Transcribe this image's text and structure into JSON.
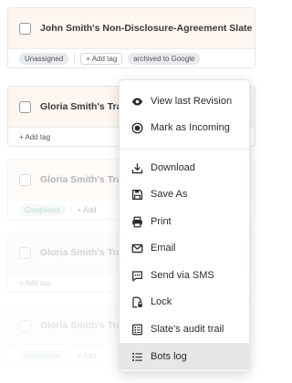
{
  "cards": [
    {
      "title": "John Smith's Non-Disclosure-Agreement Slate",
      "tags": [
        "Unassigned"
      ],
      "add_tag": "+ Add tag",
      "extra_tag": "archived to Google"
    },
    {
      "title": "Gloria Smith's Tra",
      "add_tag": "+ Add tag"
    },
    {
      "title": "Gloria Smith's Tra",
      "status": "Completed",
      "add_tag": "+ Add"
    },
    {
      "title": "Gloria Smith's Tra",
      "add_tag": "+ Add tag"
    },
    {
      "title": "Gloria Smith's Tra",
      "status": "Completed",
      "add_tag": "+ Add"
    }
  ],
  "menu": {
    "items": [
      {
        "label": "View last Revision",
        "icon": "eye-icon"
      },
      {
        "label": "Mark as Incoming",
        "icon": "radio-filled-icon"
      },
      {
        "label": "Download",
        "icon": "download-icon"
      },
      {
        "label": "Save As",
        "icon": "save-icon"
      },
      {
        "label": "Print",
        "icon": "printer-icon"
      },
      {
        "label": "Email",
        "icon": "envelope-icon"
      },
      {
        "label": "Send via SMS",
        "icon": "sms-bubble-icon"
      },
      {
        "label": "Lock",
        "icon": "lock-document-icon"
      },
      {
        "label": "Slate's audit trail",
        "icon": "audit-trail-icon"
      },
      {
        "label": "Bots log",
        "icon": "list-icon",
        "active": true
      }
    ]
  }
}
